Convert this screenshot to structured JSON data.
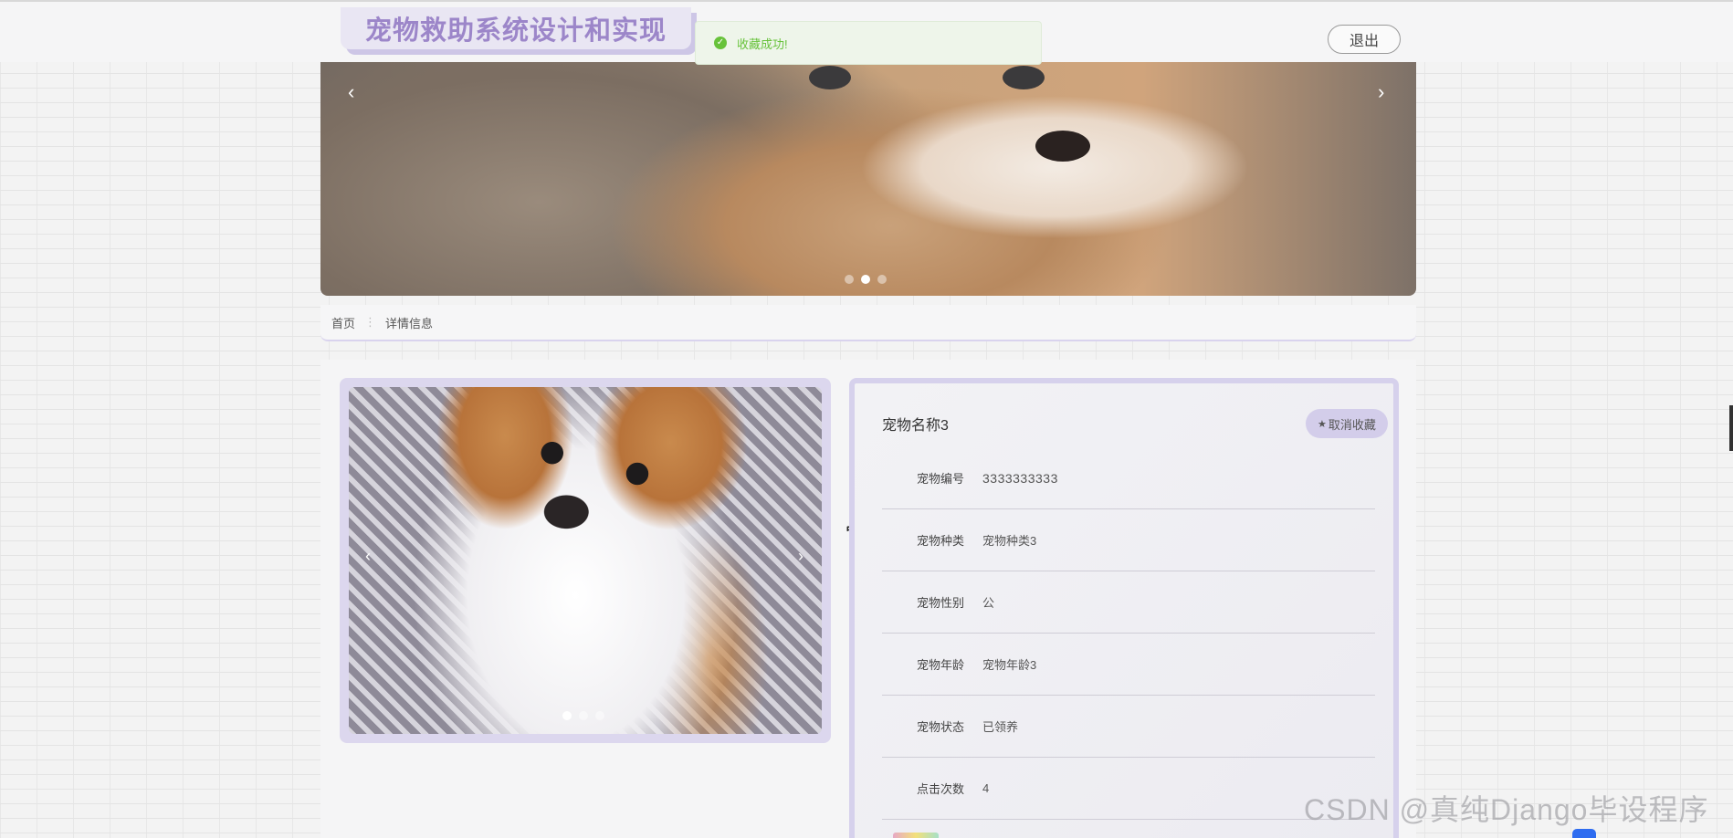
{
  "header": {
    "site_title": "宠物救助系统设计和实现",
    "logout_label": "退出"
  },
  "toast": {
    "message": "收藏成功!",
    "color": "#67c23a"
  },
  "banner": {
    "prev_arrow": "‹",
    "next_arrow": "›",
    "slide_count": 3,
    "active_slide": 2
  },
  "breadcrumb": {
    "home": "首页",
    "separator": "⋮",
    "current": "详情信息"
  },
  "gallery": {
    "prev_arrow": "‹",
    "next_arrow": "›",
    "slide_count": 3,
    "active_slide": 1
  },
  "pet": {
    "name": "宠物名称3",
    "favorite_button": "取消收藏",
    "favorite_icon": "star-icon",
    "fields": [
      {
        "label": "宠物编号",
        "value": "3333333333"
      },
      {
        "label": "宠物种类",
        "value": "宠物种类3"
      },
      {
        "label": "宠物性别",
        "value": "公"
      },
      {
        "label": "宠物年龄",
        "value": "宠物年龄3"
      },
      {
        "label": "宠物状态",
        "value": "已领养"
      },
      {
        "label": "点击次数",
        "value": "4"
      }
    ]
  },
  "watermark": "CSDN @真纯Django毕设程序",
  "colors": {
    "accent": "#9c86c9",
    "card_border": "#d6d1ec",
    "success": "#67c23a"
  }
}
